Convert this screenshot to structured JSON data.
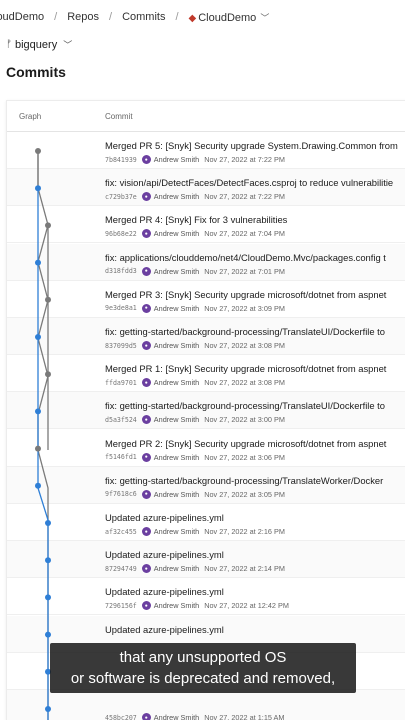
{
  "breadcrumb": {
    "org": "loudDemo",
    "section": "Repos",
    "page": "Commits",
    "project": "CloudDemo"
  },
  "branch": {
    "name": "bigquery"
  },
  "page_title": "Commits",
  "table": {
    "col_graph": "Graph",
    "col_commit": "Commit"
  },
  "commits": [
    {
      "title": "Merged PR 5: [Snyk] Security upgrade System.Drawing.Common from",
      "hash": "7b841939",
      "author": "Andrew Smith",
      "date": "Nov 27, 2022 at 7:22 PM"
    },
    {
      "title": "fix: vision/api/DetectFaces/DetectFaces.csproj to reduce vulnerabilitie",
      "hash": "c729b37e",
      "author": "Andrew Smith",
      "date": "Nov 27, 2022 at 7:22 PM"
    },
    {
      "title": "Merged PR 4: [Snyk] Fix for 3 vulnerabilities",
      "hash": "96b68e22",
      "author": "Andrew Smith",
      "date": "Nov 27, 2022 at 7:04 PM"
    },
    {
      "title": "fix: applications/clouddemo/net4/CloudDemo.Mvc/packages.config t",
      "hash": "d318fdd3",
      "author": "Andrew Smith",
      "date": "Nov 27, 2022 at 7:01 PM"
    },
    {
      "title": "Merged PR 3: [Snyk] Security upgrade microsoft/dotnet from aspnet",
      "hash": "9e3de8a1",
      "author": "Andrew Smith",
      "date": "Nov 27, 2022 at 3:09 PM"
    },
    {
      "title": "fix: getting-started/background-processing/TranslateUI/Dockerfile to",
      "hash": "837099d5",
      "author": "Andrew Smith",
      "date": "Nov 27, 2022 at 3:08 PM"
    },
    {
      "title": "Merged PR 1: [Snyk] Security upgrade microsoft/dotnet from aspnet",
      "hash": "ffda9701",
      "author": "Andrew Smith",
      "date": "Nov 27, 2022 at 3:08 PM"
    },
    {
      "title": "fix: getting-started/background-processing/TranslateUI/Dockerfile to",
      "hash": "d5a3f524",
      "author": "Andrew Smith",
      "date": "Nov 27, 2022 at 3:00 PM"
    },
    {
      "title": "Merged PR 2: [Snyk] Security upgrade microsoft/dotnet from aspnet",
      "hash": "f5146fd1",
      "author": "Andrew Smith",
      "date": "Nov 27, 2022 at 3:06 PM"
    },
    {
      "title": "fix: getting-started/background-processing/TranslateWorker/Docker",
      "hash": "9f7618c6",
      "author": "Andrew Smith",
      "date": "Nov 27, 2022 at 3:05 PM"
    },
    {
      "title": "Updated azure-pipelines.yml",
      "hash": "af32c455",
      "author": "Andrew Smith",
      "date": "Nov 27, 2022 at 2:16 PM"
    },
    {
      "title": "Updated azure-pipelines.yml",
      "hash": "87294749",
      "author": "Andrew Smith",
      "date": "Nov 27, 2022 at 2:14 PM"
    },
    {
      "title": "Updated azure-pipelines.yml",
      "hash": "7296156f",
      "author": "Andrew Smith",
      "date": "Nov 27, 2022 at 12:42 PM"
    },
    {
      "title": "Updated azure-pipelines.yml",
      "hash": "",
      "author": "",
      "date": ""
    },
    {
      "title": "",
      "hash": "",
      "author": "",
      "date": ""
    },
    {
      "title": "",
      "hash": "458bc207",
      "author": "Andrew Smith",
      "date": "Nov 27, 2022 at 1:15 AM"
    }
  ],
  "caption": {
    "line1": "that any unsupported OS",
    "line2": "or software is deprecated and removed,"
  },
  "colors": {
    "graph_blue": "#2f7fd6",
    "graph_gray": "#7a7a7a",
    "avatar": "#6b3fa0"
  },
  "icons": {
    "project": "project-icon",
    "branch": "branch-icon",
    "chevron": "chevron-down-icon"
  }
}
